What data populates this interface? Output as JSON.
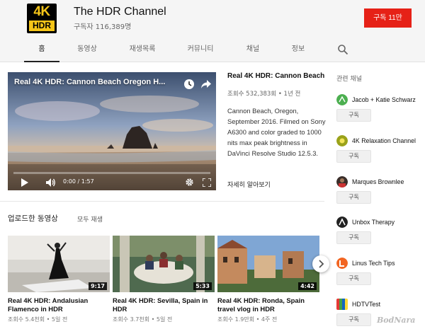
{
  "channel": {
    "logo_top": "4K",
    "logo_bottom": "HDR",
    "name": "The HDR Channel",
    "subscribers": "구독자 116,389명",
    "subscribe_label": "구독  11만"
  },
  "tabs": [
    "홈",
    "동영상",
    "재생목록",
    "커뮤니티",
    "채널",
    "정보"
  ],
  "active_tab": "홈",
  "featured": {
    "player_title": "Real 4K HDR: Cannon Beach Oregon H...",
    "title": "Real 4K HDR: Cannon Beach ...",
    "meta": "조회수 532,383회 • 1년 전",
    "description": "Cannon Beach, Oregon, September 2016. Filmed on Sony A6300 and color graded to 1000 nits max peak brightness in DaVinci Resolve Studio 12.5.3.",
    "more_label": "자세히 알아보기",
    "time": "0:00 / 1:57",
    "progress": 0.0
  },
  "uploads": {
    "title": "업로드한 동영상",
    "play_all": "모두 재생",
    "videos": [
      {
        "title": "Real 4K HDR: Andalusian Flamenco in HDR",
        "meta": "조회수 5.4천회 • 5일 전",
        "duration": "9:17"
      },
      {
        "title": "Real 4K HDR: Sevilla, Spain in HDR",
        "meta": "조회수 3.7천회 • 5일 전",
        "duration": "5:33"
      },
      {
        "title": "Real 4K HDR: Ronda, Spain travel vlog in HDR",
        "meta": "조회수 1.9만회 • 4주 전",
        "duration": "4:42"
      }
    ]
  },
  "related": {
    "title": "관련 채널",
    "subscribe_label": "구독",
    "channels": [
      {
        "name": "Jacob + Katie Schwarz",
        "color": "#4caf50"
      },
      {
        "name": "4K Relaxation Channel",
        "color": "#9aa21a"
      },
      {
        "name": "Marques Brownlee",
        "color": "#3a2e2a"
      },
      {
        "name": "Unbox Therapy",
        "color": "#222222"
      },
      {
        "name": "Linus Tech Tips",
        "color": "#f26522"
      },
      {
        "name": "HDTVTest",
        "color": "#1565c0"
      }
    ]
  },
  "watermark": "BodNara",
  "colors": {
    "accent": "#e62117",
    "header_bg": "#f5f5f5"
  }
}
